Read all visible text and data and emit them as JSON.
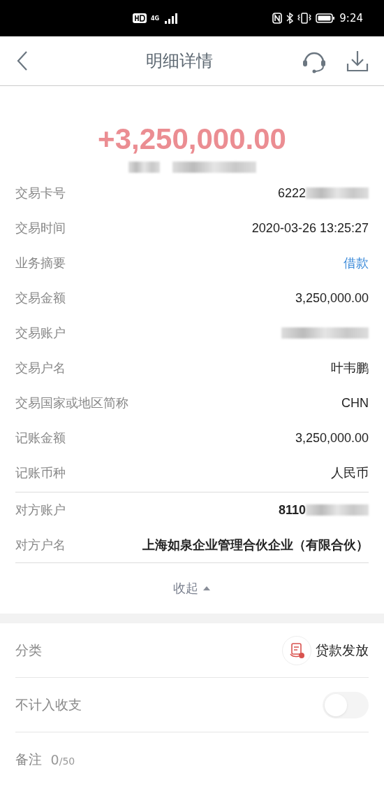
{
  "status_bar": {
    "network": "4G",
    "time": "9:24"
  },
  "header": {
    "title": "明细详情"
  },
  "amount": {
    "value": "+3,250,000.00",
    "masked_note": true
  },
  "details": [
    {
      "label": "交易卡号",
      "value": "6222",
      "kind": "plain",
      "masked": true
    },
    {
      "label": "交易时间",
      "value": "2020-03-26 13:25:27",
      "kind": "plain",
      "masked": false
    },
    {
      "label": "业务摘要",
      "value": "借款",
      "kind": "link",
      "masked": false
    },
    {
      "label": "交易金额",
      "value": "3,250,000.00",
      "kind": "plain",
      "masked": false
    },
    {
      "label": "交易账户",
      "kind": "plain",
      "masked": true
    },
    {
      "label": "交易户名",
      "value": "叶韦鹏",
      "kind": "plain",
      "masked": false
    },
    {
      "label": "交易国家或地区简称",
      "value": "CHN",
      "kind": "plain",
      "masked": false
    },
    {
      "label": "记账金额",
      "value": "3,250,000.00",
      "kind": "plain",
      "masked": false
    },
    {
      "label": "记账币种",
      "value": "人民币",
      "kind": "plain",
      "masked": false
    }
  ],
  "counterparty": [
    {
      "label": "对方账户",
      "value": "8110",
      "kind": "bold",
      "masked": true
    },
    {
      "label": "对方户名",
      "value": "上海如泉企业管理合伙企业（有限合伙）",
      "kind": "bold",
      "masked": false
    }
  ],
  "collapse": {
    "label": "收起",
    "expanded": true
  },
  "settings": [
    {
      "kind": "category",
      "label": "分类",
      "value": "贷款发放"
    },
    {
      "kind": "toggle",
      "label": "不计入收支",
      "on": false
    },
    {
      "kind": "note",
      "label": "备注",
      "count": "0",
      "max": "/50"
    }
  ]
}
